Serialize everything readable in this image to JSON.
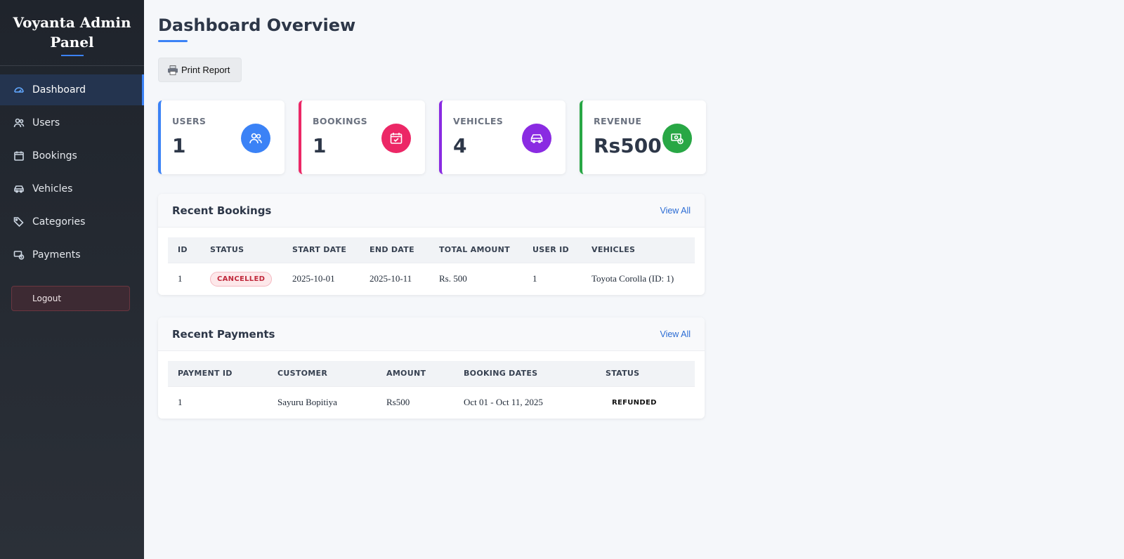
{
  "sidebar": {
    "brand": "Voyanta Admin Panel",
    "items": [
      {
        "label": "Dashboard",
        "icon": "gauge-icon",
        "active": true
      },
      {
        "label": "Users",
        "icon": "users-icon"
      },
      {
        "label": "Bookings",
        "icon": "calendar-icon"
      },
      {
        "label": "Vehicles",
        "icon": "car-icon"
      },
      {
        "label": "Categories",
        "icon": "tags-icon"
      },
      {
        "label": "Payments",
        "icon": "money-icon"
      }
    ],
    "logout_label": "Logout"
  },
  "header": {
    "title": "Dashboard Overview",
    "print_label": "Print Report"
  },
  "stats": [
    {
      "label": "USERS",
      "value": "1",
      "color": "#3b82f6",
      "icon": "users-icon"
    },
    {
      "label": "BOOKINGS",
      "value": "1",
      "color": "#ec2766",
      "icon": "calendar-check-icon"
    },
    {
      "label": "VEHICLES",
      "value": "4",
      "color": "#8a2be2",
      "icon": "car-icon"
    },
    {
      "label": "REVENUE",
      "value": "Rs500",
      "color": "#28a745",
      "icon": "money-icon"
    }
  ],
  "recent_bookings": {
    "title": "Recent Bookings",
    "view_all": "View All",
    "columns": [
      "ID",
      "STATUS",
      "START DATE",
      "END DATE",
      "TOTAL AMOUNT",
      "USER ID",
      "VEHICLES"
    ],
    "rows": [
      {
        "id": "1",
        "status": "CANCELLED",
        "start": "2025-10-01",
        "end": "2025-10-11",
        "amount": "Rs. 500",
        "user_id": "1",
        "vehicle": "Toyota Corolla (ID: 1)"
      }
    ]
  },
  "recent_payments": {
    "title": "Recent Payments",
    "view_all": "View All",
    "columns": [
      "PAYMENT ID",
      "CUSTOMER",
      "AMOUNT",
      "BOOKING DATES",
      "STATUS"
    ],
    "rows": [
      {
        "id": "1",
        "customer": "Sayuru Bopitiya",
        "amount": "Rs500",
        "dates": "Oct 01 - Oct 11, 2025",
        "status": "REFUNDED"
      }
    ]
  }
}
